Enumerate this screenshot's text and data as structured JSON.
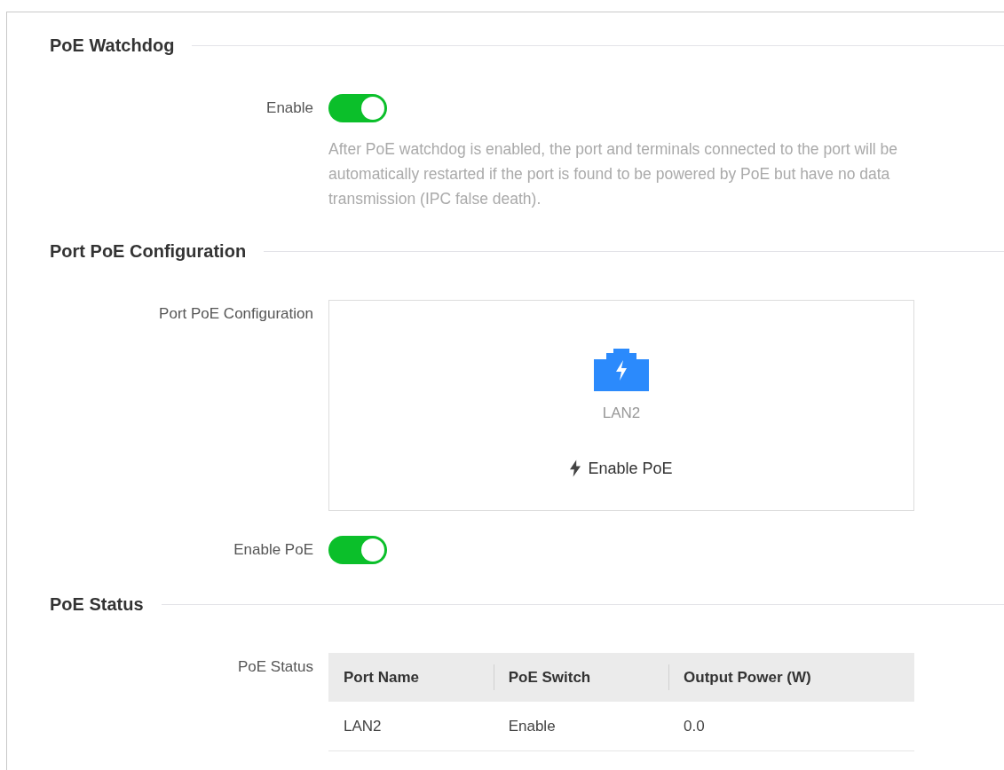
{
  "sections": [
    {
      "kind": "toggle",
      "title": "PoE Watchdog",
      "label": "Enable",
      "on": true,
      "description": "After PoE watchdog is enabled, the port and terminals connected to the port will be automatically restarted if the port is found to be powered by PoE but have no data transmission (IPC false death)."
    },
    {
      "kind": "ports",
      "title": "Port PoE Configuration",
      "label": "Port PoE Configuration",
      "ports": [
        {
          "name": "LAN2",
          "selected": true
        }
      ],
      "action": "Enable PoE",
      "toggle": {
        "label": "Enable PoE",
        "on": true
      }
    },
    {
      "kind": "table",
      "title": "PoE Status",
      "label": "PoE Status",
      "columns": [
        "Port Name",
        "PoE Switch",
        "Output Power (W)"
      ],
      "rows": [
        [
          "LAN2",
          "Enable",
          "0.0"
        ]
      ]
    }
  ]
}
